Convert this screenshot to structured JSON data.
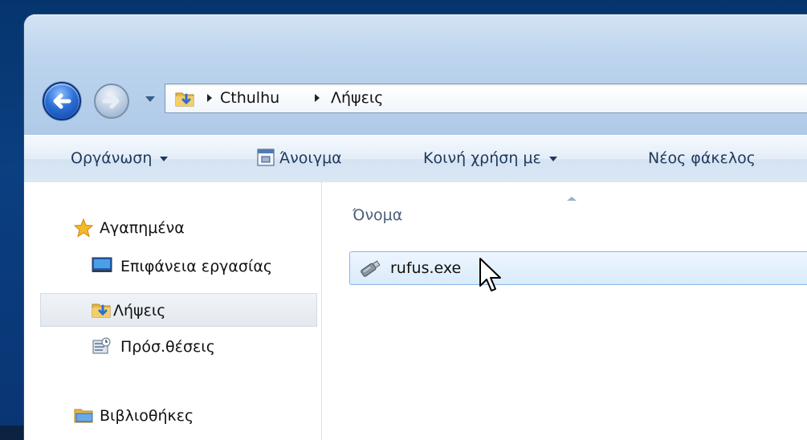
{
  "address_bar": {
    "breadcrumbs": [
      "Cthulhu",
      "Λήψεις"
    ]
  },
  "command_bar": {
    "organize": "Οργάνωση",
    "open": "Άνοιγμα",
    "share_with": "Κοινή χρήση με",
    "new_folder": "Νέος φάκελος"
  },
  "nav_pane": {
    "items": [
      {
        "label": "Αγαπημένα",
        "icon": "star-icon"
      },
      {
        "label": "Επιφάνεια εργασίας",
        "icon": "desktop-icon"
      },
      {
        "label": "Λήψεις",
        "icon": "downloads-folder-icon",
        "selected": true
      },
      {
        "label": "Πρόσ.θέσεις",
        "icon": "recent-places-icon"
      },
      {
        "label": "Βιβλιοθήκες",
        "icon": "libraries-icon"
      }
    ]
  },
  "content": {
    "column_name": "Όνομα",
    "files": [
      {
        "name": "rufus.exe",
        "icon": "usb-drive-icon",
        "hovered": true
      }
    ]
  },
  "colors": {
    "accent": "#2a6fd8",
    "selection": "#d9ebfb",
    "command_text": "#1e395b"
  }
}
